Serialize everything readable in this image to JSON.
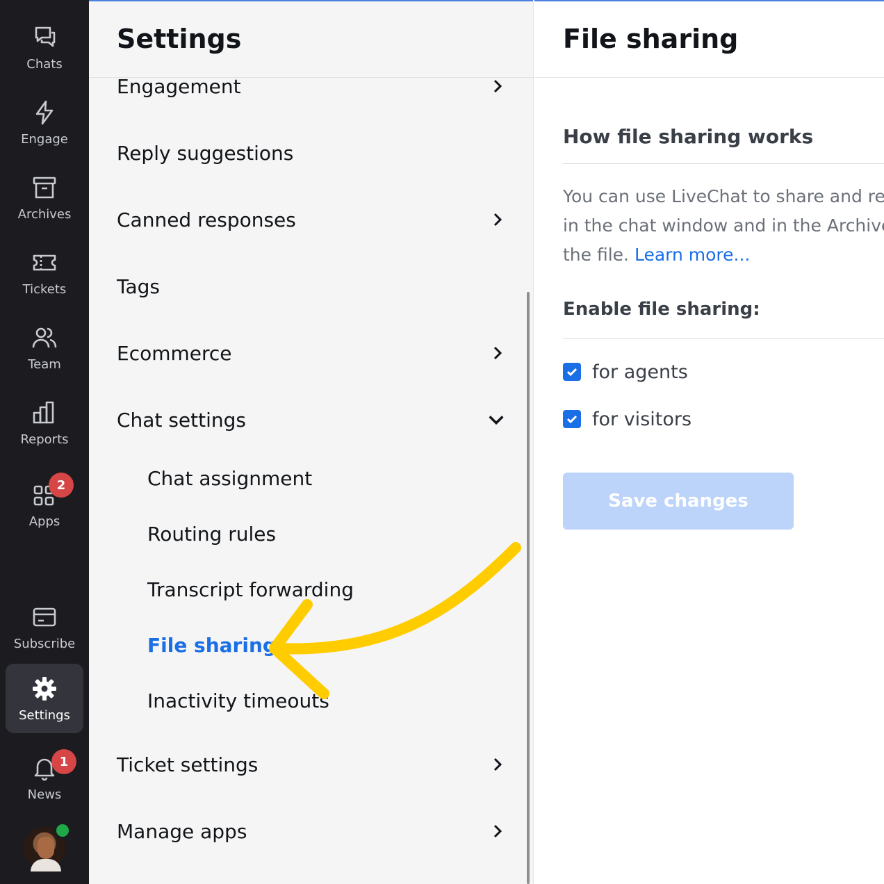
{
  "rail": {
    "items": [
      {
        "label": "Chats",
        "icon": "chats-icon"
      },
      {
        "label": "Engage",
        "icon": "lightning-icon"
      },
      {
        "label": "Archives",
        "icon": "archive-box-icon"
      },
      {
        "label": "Tickets",
        "icon": "ticket-icon"
      },
      {
        "label": "Team",
        "icon": "team-icon"
      },
      {
        "label": "Reports",
        "icon": "bar-chart-icon"
      },
      {
        "label": "Apps",
        "icon": "apps-grid-icon",
        "badge": "2"
      },
      {
        "label": "Subscribe",
        "icon": "credit-card-icon"
      },
      {
        "label": "Settings",
        "icon": "gear-icon",
        "active": true
      },
      {
        "label": "News",
        "icon": "bell-icon",
        "badge": "1"
      }
    ],
    "avatar_status": "online"
  },
  "settings": {
    "title": "Settings",
    "items": [
      {
        "label": "Engagement",
        "chevron": "right"
      },
      {
        "label": "Reply suggestions"
      },
      {
        "label": "Canned responses",
        "chevron": "right"
      },
      {
        "label": "Tags"
      },
      {
        "label": "Ecommerce",
        "chevron": "right"
      },
      {
        "label": "Chat settings",
        "chevron": "down"
      },
      {
        "label": "Ticket settings",
        "chevron": "right"
      },
      {
        "label": "Manage apps",
        "chevron": "right"
      }
    ],
    "chat_settings_sub": [
      {
        "label": "Chat assignment"
      },
      {
        "label": "Routing rules"
      },
      {
        "label": "Transcript forwarding"
      },
      {
        "label": "File sharing",
        "current": true
      },
      {
        "label": "Inactivity timeouts"
      }
    ]
  },
  "content": {
    "title": "File sharing",
    "section_heading": "How file sharing works",
    "description_lines": [
      "You can use LiveChat to share and receiv",
      "in the chat window and in the Archives. A",
      "the file. "
    ],
    "learn_more": "Learn more...",
    "enable_label": "Enable file sharing:",
    "options": [
      {
        "label": "for agents",
        "checked": true
      },
      {
        "label": "for visitors",
        "checked": true
      }
    ],
    "save_button": "Save changes"
  },
  "colors": {
    "rail_bg": "#1b1b20",
    "accent": "#1a6ee6",
    "badge": "#d64646",
    "annotation_arrow": "#ffcc00",
    "save_disabled": "#bcd3fa"
  }
}
